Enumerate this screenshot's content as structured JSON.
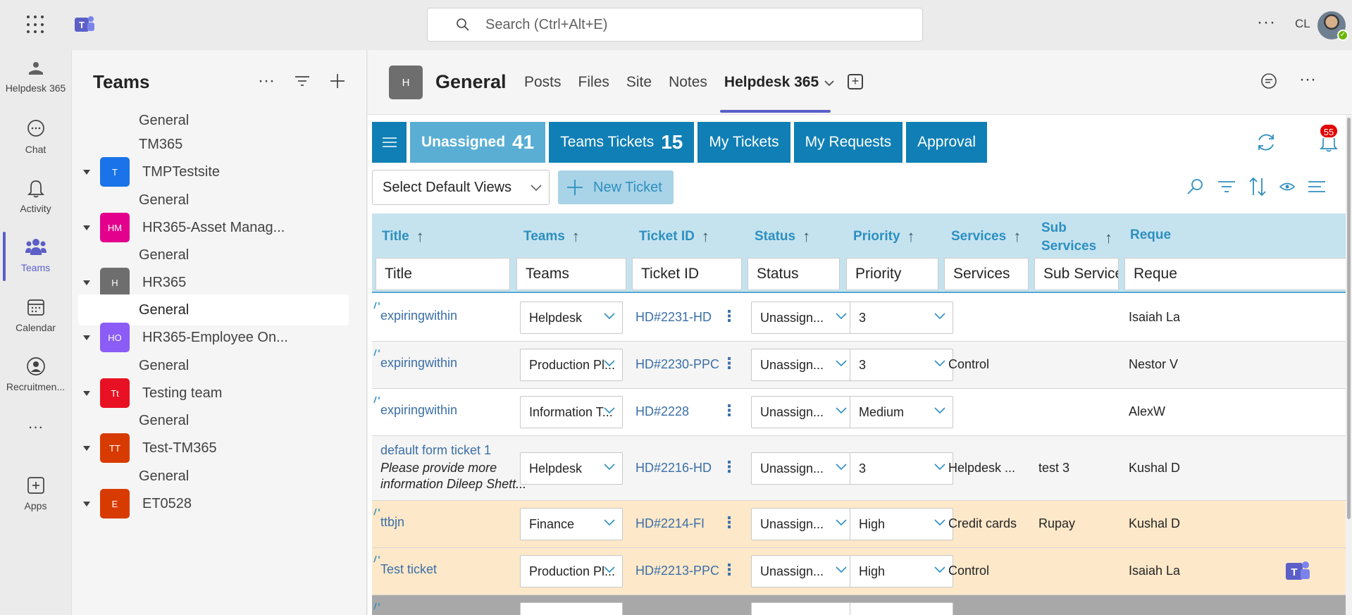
{
  "topbar": {
    "search_placeholder": "Search (Ctrl+Alt+E)",
    "more": "···",
    "initials": "CL"
  },
  "rail": {
    "items": [
      {
        "label": "Helpdesk 365",
        "icon": "helpdesk-icon"
      },
      {
        "label": "Chat",
        "icon": "chat-icon"
      },
      {
        "label": "Activity",
        "icon": "bell-icon"
      },
      {
        "label": "Teams",
        "icon": "teams-icon"
      },
      {
        "label": "Calendar",
        "icon": "calendar-icon"
      },
      {
        "label": "Recruitmen...",
        "icon": "recruitment-icon"
      },
      {
        "label": "···",
        "icon": "more-icon"
      },
      {
        "label": "Apps",
        "icon": "apps-icon"
      }
    ]
  },
  "teams_panel": {
    "title": "Teams",
    "tree": [
      {
        "type": "channel",
        "label": "General"
      },
      {
        "type": "channel",
        "label": "TM365"
      },
      {
        "type": "team",
        "label": "TMPTestsite",
        "badge": "T",
        "color": "#1a73e8"
      },
      {
        "type": "channel",
        "label": "General"
      },
      {
        "type": "team",
        "label": "HR365-Asset Manag...",
        "badge": "HM",
        "color": "#e3008c"
      },
      {
        "type": "channel",
        "label": "General"
      },
      {
        "type": "team",
        "label": "HR365",
        "badge": "H",
        "color": "#6e6e6e"
      },
      {
        "type": "channel",
        "label": "General",
        "selected": true
      },
      {
        "type": "team",
        "label": "HR365-Employee On...",
        "badge": "HO",
        "color": "#8b5cf6"
      },
      {
        "type": "channel",
        "label": "General"
      },
      {
        "type": "team",
        "label": "Testing team",
        "badge": "Tt",
        "color": "#e81123"
      },
      {
        "type": "channel",
        "label": "General"
      },
      {
        "type": "team",
        "label": "Test-TM365",
        "badge": "TT",
        "color": "#d83b01"
      },
      {
        "type": "channel",
        "label": "General"
      },
      {
        "type": "team",
        "label": "ET0528",
        "badge": "E",
        "color": "#d83b01"
      }
    ]
  },
  "header": {
    "badge": "H",
    "title": "General",
    "tabs": [
      "Posts",
      "Files",
      "Site",
      "Notes",
      "Helpdesk 365"
    ],
    "active_tab": "Helpdesk 365"
  },
  "app": {
    "nav": {
      "unassigned_label": "Unassigned",
      "unassigned_count": "41",
      "teams_tickets_label": "Teams Tickets",
      "teams_tickets_count": "15",
      "my_tickets": "My Tickets",
      "my_requests": "My Requests",
      "approval": "Approval"
    },
    "notification_count": "55",
    "views_select": "Select Default Views",
    "new_ticket": "New Ticket",
    "columns": {
      "title": "Title",
      "teams": "Teams",
      "ticket_id": "Ticket ID",
      "status": "Status",
      "priority": "Priority",
      "services": "Services",
      "sub_services_1": "Sub",
      "sub_services_2": "Services",
      "requester": "Reque"
    },
    "filters": {
      "title": "Title",
      "teams": "Teams",
      "ticket_id": "Ticket ID",
      "status": "Status",
      "priority": "Priority",
      "services": "Services",
      "sub_services": "Sub Services",
      "requester": "Reque"
    },
    "rows": [
      {
        "title": "expiringwithin",
        "subtitle": "",
        "team": "Helpdesk",
        "id": "HD#2231-HD",
        "status": "Unassign...",
        "priority": "3",
        "services": "",
        "sub_services": "",
        "requester": "Isaiah La"
      },
      {
        "title": "expiringwithin",
        "subtitle": "",
        "team": "Production Pl...",
        "id": "HD#2230-PPC",
        "status": "Unassign...",
        "priority": "3",
        "services": "Control",
        "sub_services": "",
        "requester": "Nestor V"
      },
      {
        "title": "expiringwithin",
        "subtitle": "",
        "team": "Information T...",
        "id": "HD#2228",
        "status": "Unassign...",
        "priority": "Medium",
        "services": "",
        "sub_services": "",
        "requester": "AlexW"
      },
      {
        "title": "default form ticket 1",
        "subtitle_1": "Please provide more",
        "subtitle_2": "information Dileep Shett...",
        "team": "Helpdesk",
        "id": "HD#2216-HD",
        "status": "Unassign...",
        "priority": "3",
        "services": "Helpdesk ...",
        "sub_services": "test 3",
        "requester": "Kushal D"
      },
      {
        "title": "ttbjn",
        "subtitle": "",
        "team": "Finance",
        "id": "HD#2214-FI",
        "status": "Unassign...",
        "priority": "High",
        "services": "Credit cards",
        "sub_services": "Rupay",
        "requester": "Kushal D"
      },
      {
        "title": "Test ticket",
        "subtitle": "",
        "team": "Production Pl...",
        "id": "HD#2213-PPC",
        "status": "Unassign...",
        "priority": "High",
        "services": "Control",
        "sub_services": "",
        "requester": "Isaiah La"
      }
    ]
  }
}
